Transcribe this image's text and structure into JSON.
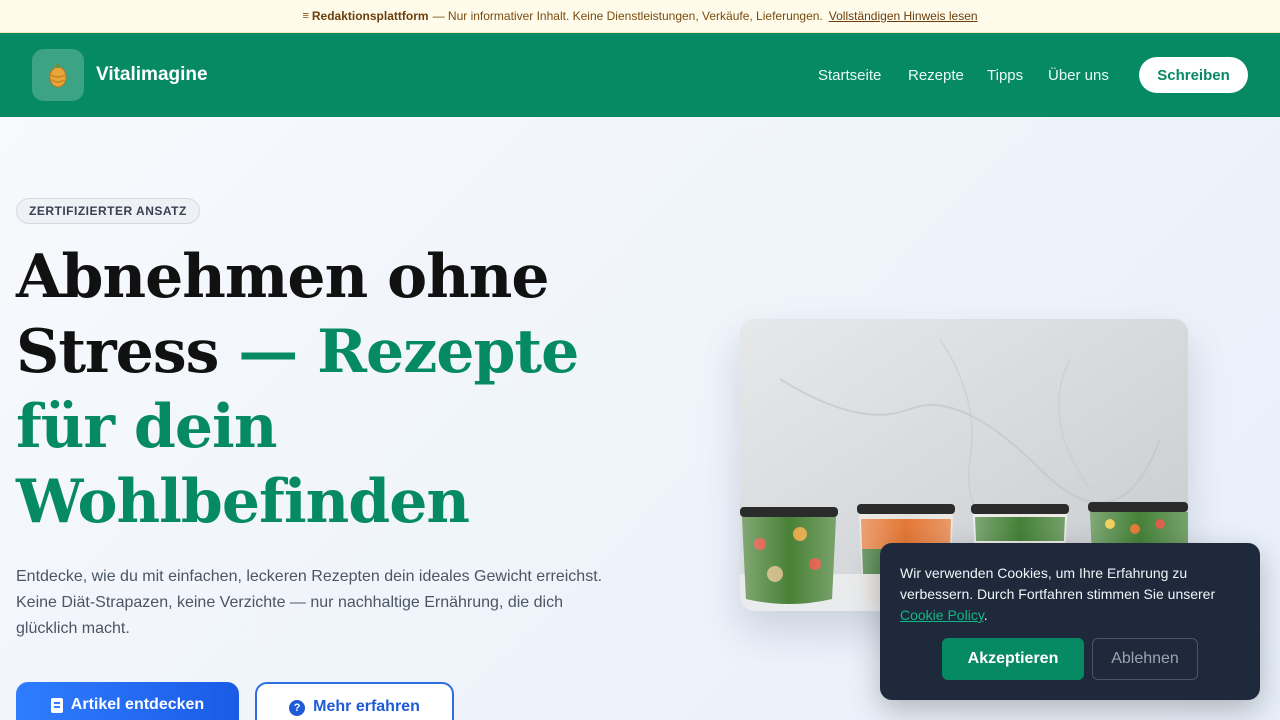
{
  "notice": {
    "icon": "document-lines-icon",
    "title": "Redaktionsplattform",
    "text": "— Nur informativer Inhalt. Keine Dienstleistungen, Verkäufe, Lieferungen.",
    "link": "Vollständigen Hinweis lesen"
  },
  "header": {
    "logo_icon": "golden-egg-icon",
    "brand": "Vitalimagine",
    "nav": [
      "Startseite",
      "Rezepte",
      "Tipps",
      "Über uns"
    ],
    "cta": "Schreiben",
    "background": "#068a63"
  },
  "hero": {
    "badge": "ZERTIFIZIERTER ANSATZ",
    "headline_dark": "Abnehmen ohne Stress",
    "headline_accent": "— Rezepte für dein Wohlbefinden",
    "lead": "Entdecke, wie du mit einfachen, leckeren Rezepten dein ideales Gewicht erreichst. Keine Diät-Strapazen, keine Verzichte — nur nachhaltige Ernährung, die dich glücklich macht.",
    "primary_button": "Artikel entdecken",
    "primary_icon": "book-icon",
    "secondary_button": "Mehr erfahren",
    "secondary_icon": "question-circle-icon",
    "accent_color": "#068a63",
    "image_alt": "meal-prep-jars-image"
  },
  "cookie": {
    "text": "Wir verwenden Cookies, um Ihre Erfahrung zu verbessern. Durch Fortfahren stimmen Sie unserer",
    "policy_link": "Cookie Policy",
    "policy_suffix": ".",
    "accept": "Akzeptieren",
    "decline": "Ablehnen"
  }
}
